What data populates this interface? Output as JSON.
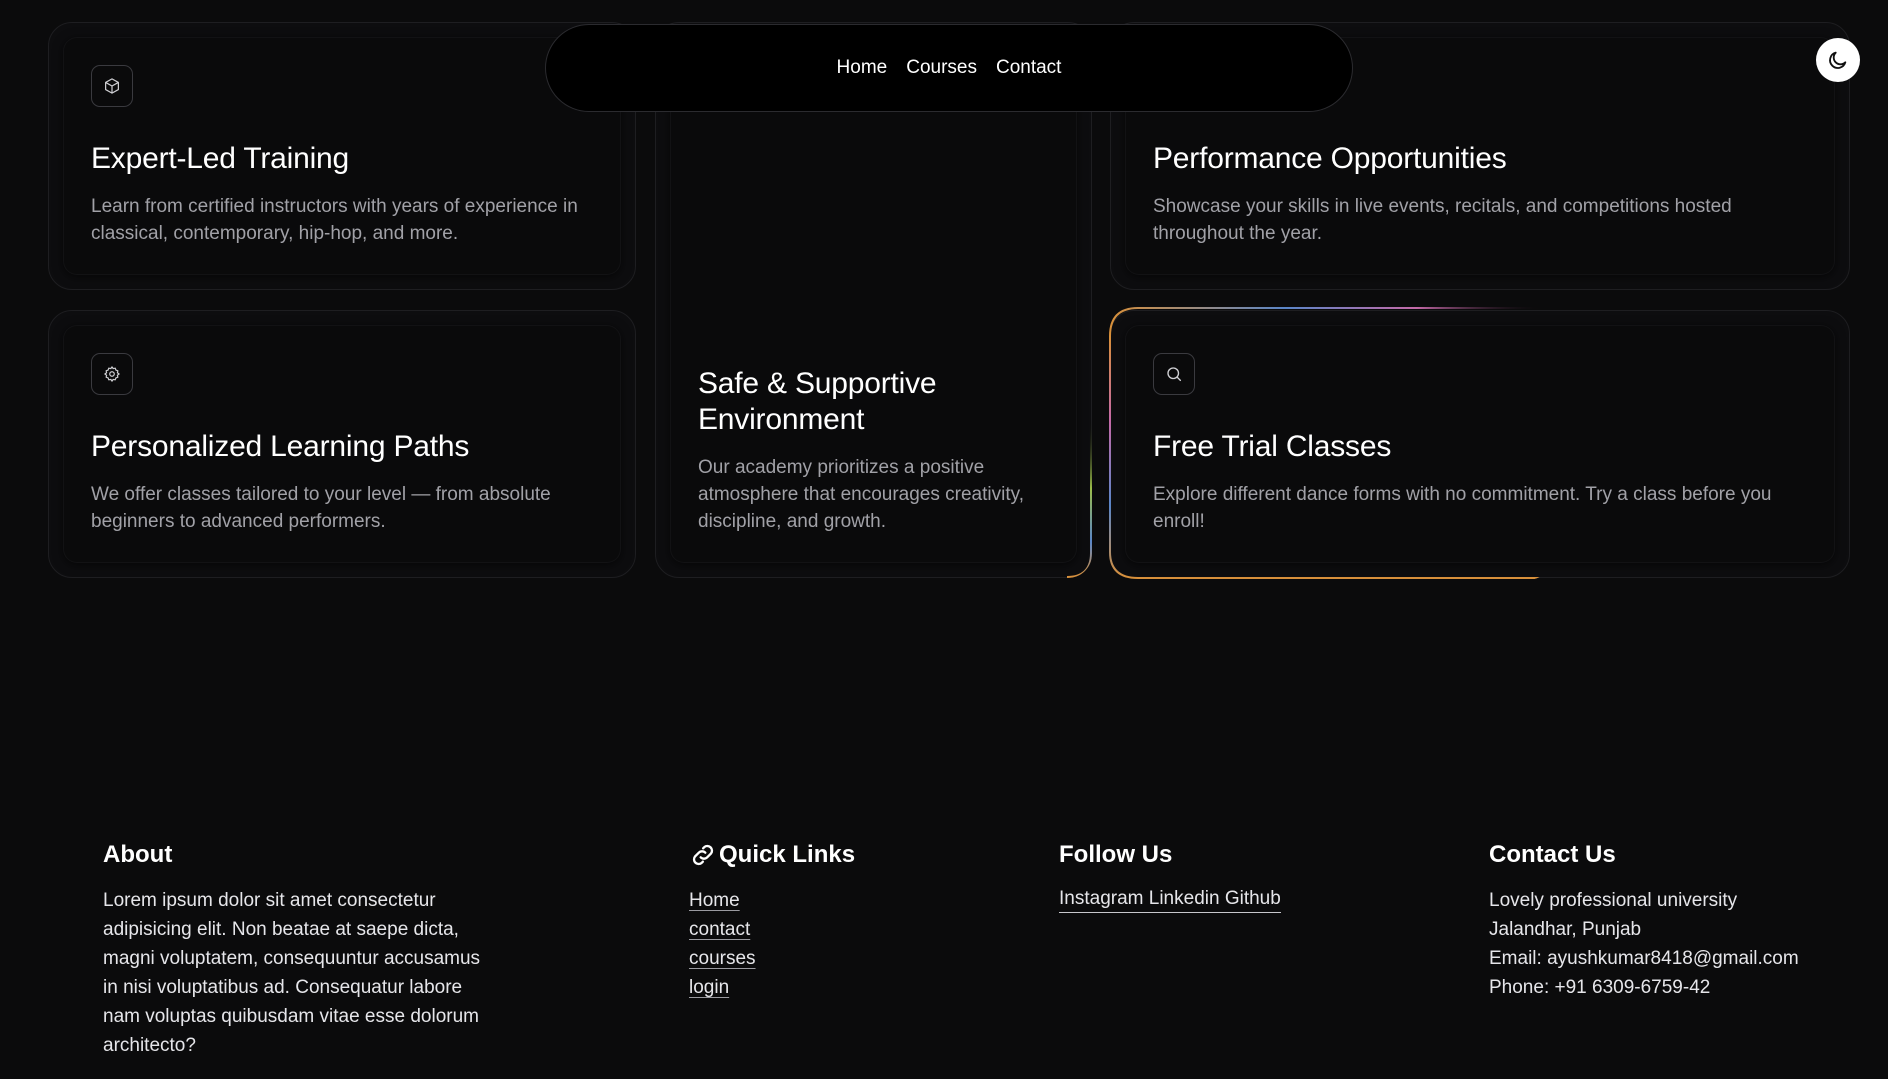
{
  "nav": {
    "links": [
      "Home",
      "Courses",
      "Contact"
    ]
  },
  "theme_toggle": {
    "icon": "moon-icon"
  },
  "features": [
    {
      "title": "Expert-Led Training",
      "description": "Learn from certified instructors with years of experience in classical, contemporary, hip-hop, and more.",
      "icon": "box-icon"
    },
    {
      "title": "Performance Opportunities",
      "description": "Showcase your skills in live events, recitals, and competitions hosted throughout the year."
    },
    {
      "title": "Personalized Learning Paths",
      "description": "We offer classes tailored to your level — from absolute beginners to advanced performers.",
      "icon": "settings-icon"
    },
    {
      "title": "Safe & Supportive Environment",
      "description": "Our academy prioritizes a positive atmosphere that encourages creativity, discipline, and growth."
    },
    {
      "title": "Free Trial Classes",
      "description": "Explore different dance forms with no commitment. Try a class before you enroll!",
      "icon": "search-icon"
    }
  ],
  "footer": {
    "about": {
      "heading": "About",
      "text": "Lorem ipsum dolor sit amet consectetur adipisicing elit. Non beatae at saepe dicta, magni voluptatem, consequuntur accusamus in nisi voluptatibus ad. Consequatur labore nam voluptas quibusdam vitae esse dolorum architecto?"
    },
    "quick_links": {
      "heading": "Quick Links",
      "icon": "link-icon",
      "links": [
        "Home",
        "contact",
        "courses",
        "login"
      ]
    },
    "follow": {
      "heading": "Follow Us",
      "links": [
        "Instagram",
        "Linkedin",
        "Github"
      ]
    },
    "contact": {
      "heading": "Contact Us",
      "lines": [
        "Lovely professional university",
        "Jalandhar, Punjab",
        "Email: ayushkumar8418@gmail.com",
        "Phone: +91 6309-6759-42"
      ]
    }
  },
  "colors": {
    "background": "#0b0b0c",
    "card_text_muted": "#a1a1a7",
    "glow_orange": "#d9903a",
    "glow_pink": "#c56aa8",
    "glow_blue": "#5a86c8"
  }
}
